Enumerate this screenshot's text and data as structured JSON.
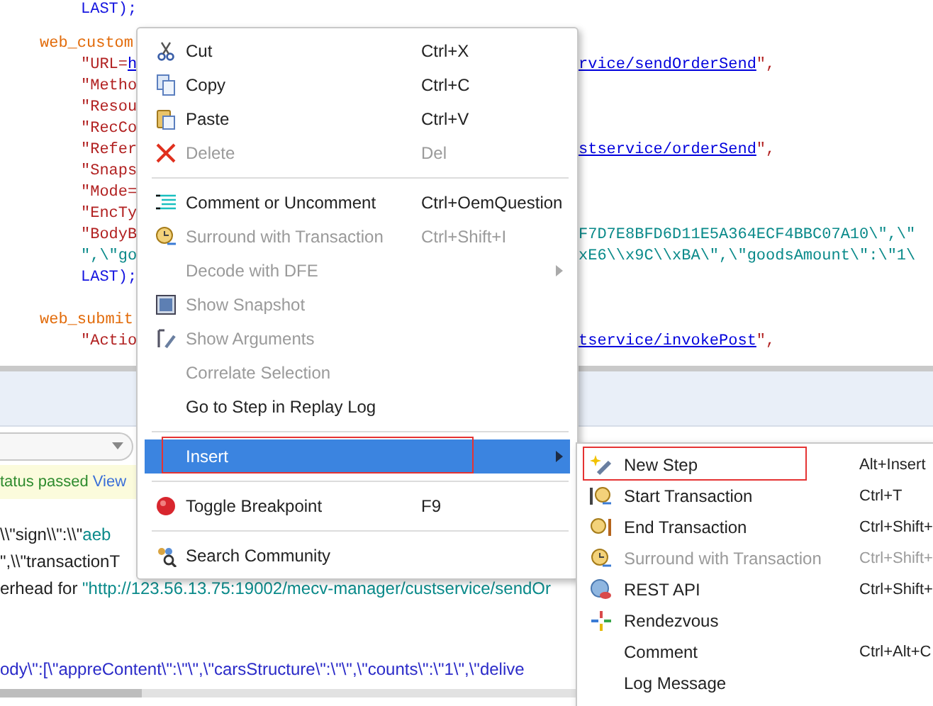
{
  "editor": {
    "blocks": [
      {
        "lines": [
          {
            "left": [
              {
                "text": "LAST);",
                "kind": "constant"
              }
            ]
          }
        ]
      },
      {
        "lines": [
          {
            "left": [
              {
                "text": "web_custom",
                "kind": "function"
              }
            ]
          },
          {
            "left": [
              {
                "text": "\"URL=",
                "kind": "string"
              },
              {
                "text": "h",
                "kind": "link"
              }
            ],
            "right": [
              {
                "text": "rvice/sendOrderSend",
                "kind": "link"
              },
              {
                "text": "\",",
                "kind": "string"
              }
            ]
          },
          {
            "left": [
              {
                "text": "\"Metho",
                "kind": "string"
              }
            ]
          },
          {
            "left": [
              {
                "text": "\"Resou",
                "kind": "string"
              }
            ]
          },
          {
            "left": [
              {
                "text": "\"RecCo",
                "kind": "string"
              }
            ]
          },
          {
            "left": [
              {
                "text": "\"Refer",
                "kind": "string"
              }
            ],
            "right": [
              {
                "text": "stservice/orderSend",
                "kind": "link"
              },
              {
                "text": "\",",
                "kind": "string"
              }
            ]
          },
          {
            "left": [
              {
                "text": "\"Snaps",
                "kind": "string"
              }
            ]
          },
          {
            "left": [
              {
                "text": "\"Mode=",
                "kind": "string"
              }
            ]
          },
          {
            "left": [
              {
                "text": "\"EncTy",
                "kind": "string"
              }
            ]
          },
          {
            "left": [
              {
                "text": "\"BodyB",
                "kind": "string"
              }
            ],
            "right": [
              {
                "text": "F7D7E8BFD6D11E5A364ECF4BBC07A10\\\",\\\"",
                "kind": "data"
              }
            ]
          },
          {
            "left": [
              {
                "text": "\",\\\"go",
                "kind": "data"
              }
            ],
            "right": [
              {
                "text": "xE6\\\\x9C\\\\xBA\\\",\\\"goodsAmount\\\":\\\"1\\",
                "kind": "data"
              }
            ]
          },
          {
            "left": [
              {
                "text": "LAST);",
                "kind": "constant"
              }
            ]
          }
        ]
      },
      {
        "lines": [
          {
            "left": [
              {
                "text": "web_submit",
                "kind": "function"
              }
            ]
          },
          {
            "left": [
              {
                "text": "\"Actio",
                "kind": "string"
              }
            ],
            "right": [
              {
                "text": "tservice/invokePost",
                "kind": "link"
              },
              {
                "text": "\",",
                "kind": "string"
              }
            ]
          }
        ]
      }
    ]
  },
  "log_panel": {
    "status": {
      "text": "tatus passed",
      "link": "View"
    },
    "groups": [
      {
        "lines": [
          {
            "segments": [
              {
                "text": "\\\\\"sign\\\\\":\\\\\"",
                "kind": "plain"
              },
              {
                "text": "aeb",
                "kind": "data"
              }
            ]
          },
          {
            "segments": [
              {
                "text": "\",\\\\\"transactionT",
                "kind": "plain"
              }
            ]
          },
          {
            "segments": [
              {
                "text": "erhead for ",
                "kind": "plain"
              },
              {
                "text": "\"http://123.56.13.75:19002/mecv-manager/custservice/sendOr",
                "kind": "data"
              }
            ]
          }
        ]
      },
      {
        "lines": [
          {
            "segments": [
              {
                "text": "ody\\\":[\\\"appreContent\\\":\\\"\\\",\\\"carsStructure\\\":\\\"\\\",\\\"counts\\\":\\\"1\\\",\\\"delive",
                "kind": "body"
              }
            ]
          }
        ]
      }
    ]
  },
  "context_menu": {
    "items": [
      {
        "kind": "item",
        "label": "Cut",
        "shortcut": "Ctrl+X",
        "disabled": false,
        "has_submenu": false,
        "selected": false,
        "outlined": false
      },
      {
        "kind": "item",
        "label": "Copy",
        "shortcut": "Ctrl+C",
        "disabled": false,
        "has_submenu": false,
        "selected": false,
        "outlined": false
      },
      {
        "kind": "item",
        "label": "Paste",
        "shortcut": "Ctrl+V",
        "disabled": false,
        "has_submenu": false,
        "selected": false,
        "outlined": false
      },
      {
        "kind": "item",
        "label": "Delete",
        "shortcut": "Del",
        "disabled": true,
        "has_submenu": false,
        "selected": false,
        "outlined": false
      },
      {
        "kind": "separator"
      },
      {
        "kind": "item",
        "label": "Comment or Uncomment",
        "shortcut": "Ctrl+OemQuestion",
        "disabled": false,
        "has_submenu": false,
        "selected": false,
        "outlined": false
      },
      {
        "kind": "item",
        "label": "Surround with Transaction",
        "shortcut": "Ctrl+Shift+I",
        "disabled": true,
        "has_submenu": false,
        "selected": false,
        "outlined": false
      },
      {
        "kind": "item",
        "label": "Decode with DFE",
        "disabled": true,
        "has_submenu": true,
        "selected": false,
        "outlined": false
      },
      {
        "kind": "item",
        "label": "Show Snapshot",
        "disabled": true,
        "has_submenu": false,
        "selected": false,
        "outlined": false
      },
      {
        "kind": "item",
        "label": "Show Arguments",
        "disabled": true,
        "has_submenu": false,
        "selected": false,
        "outlined": false
      },
      {
        "kind": "item",
        "label": "Correlate Selection",
        "disabled": true,
        "has_submenu": false,
        "selected": false,
        "outlined": false
      },
      {
        "kind": "item",
        "label": "Go to Step in Replay Log",
        "disabled": false,
        "has_submenu": false,
        "selected": false,
        "outlined": false
      },
      {
        "kind": "separator"
      },
      {
        "kind": "item",
        "label": "Insert",
        "disabled": false,
        "has_submenu": true,
        "selected": true,
        "outlined": true
      },
      {
        "kind": "separator"
      },
      {
        "kind": "item",
        "label": "Toggle Breakpoint",
        "shortcut": "F9",
        "disabled": false,
        "has_submenu": false,
        "selected": false,
        "outlined": false
      },
      {
        "kind": "separator"
      },
      {
        "kind": "item",
        "label": "Search Community",
        "disabled": false,
        "has_submenu": false,
        "selected": false,
        "outlined": false
      }
    ]
  },
  "submenu": {
    "items": [
      {
        "kind": "item",
        "label": "New Step",
        "shortcut": "Alt+Insert",
        "disabled": false,
        "selected": false,
        "outlined": true
      },
      {
        "kind": "item",
        "label": "Start Transaction",
        "shortcut": "Ctrl+T",
        "disabled": false,
        "selected": false,
        "outlined": false
      },
      {
        "kind": "item",
        "label": "End Transaction",
        "shortcut": "Ctrl+Shift+",
        "disabled": false,
        "selected": false,
        "outlined": false
      },
      {
        "kind": "item",
        "label": "Surround with Transaction",
        "shortcut": "Ctrl+Shift+",
        "disabled": true,
        "selected": false,
        "outlined": false
      },
      {
        "kind": "item",
        "label": "REST API",
        "shortcut": "Ctrl+Shift+",
        "disabled": false,
        "selected": false,
        "outlined": false
      },
      {
        "kind": "item",
        "label": "Rendezvous",
        "disabled": false,
        "selected": false,
        "outlined": false
      },
      {
        "kind": "item",
        "label": "Comment",
        "shortcut": "Ctrl+Alt+C",
        "disabled": false,
        "selected": false,
        "outlined": false
      },
      {
        "kind": "item",
        "label": "Log Message",
        "disabled": false,
        "selected": false,
        "outlined": false
      }
    ]
  }
}
